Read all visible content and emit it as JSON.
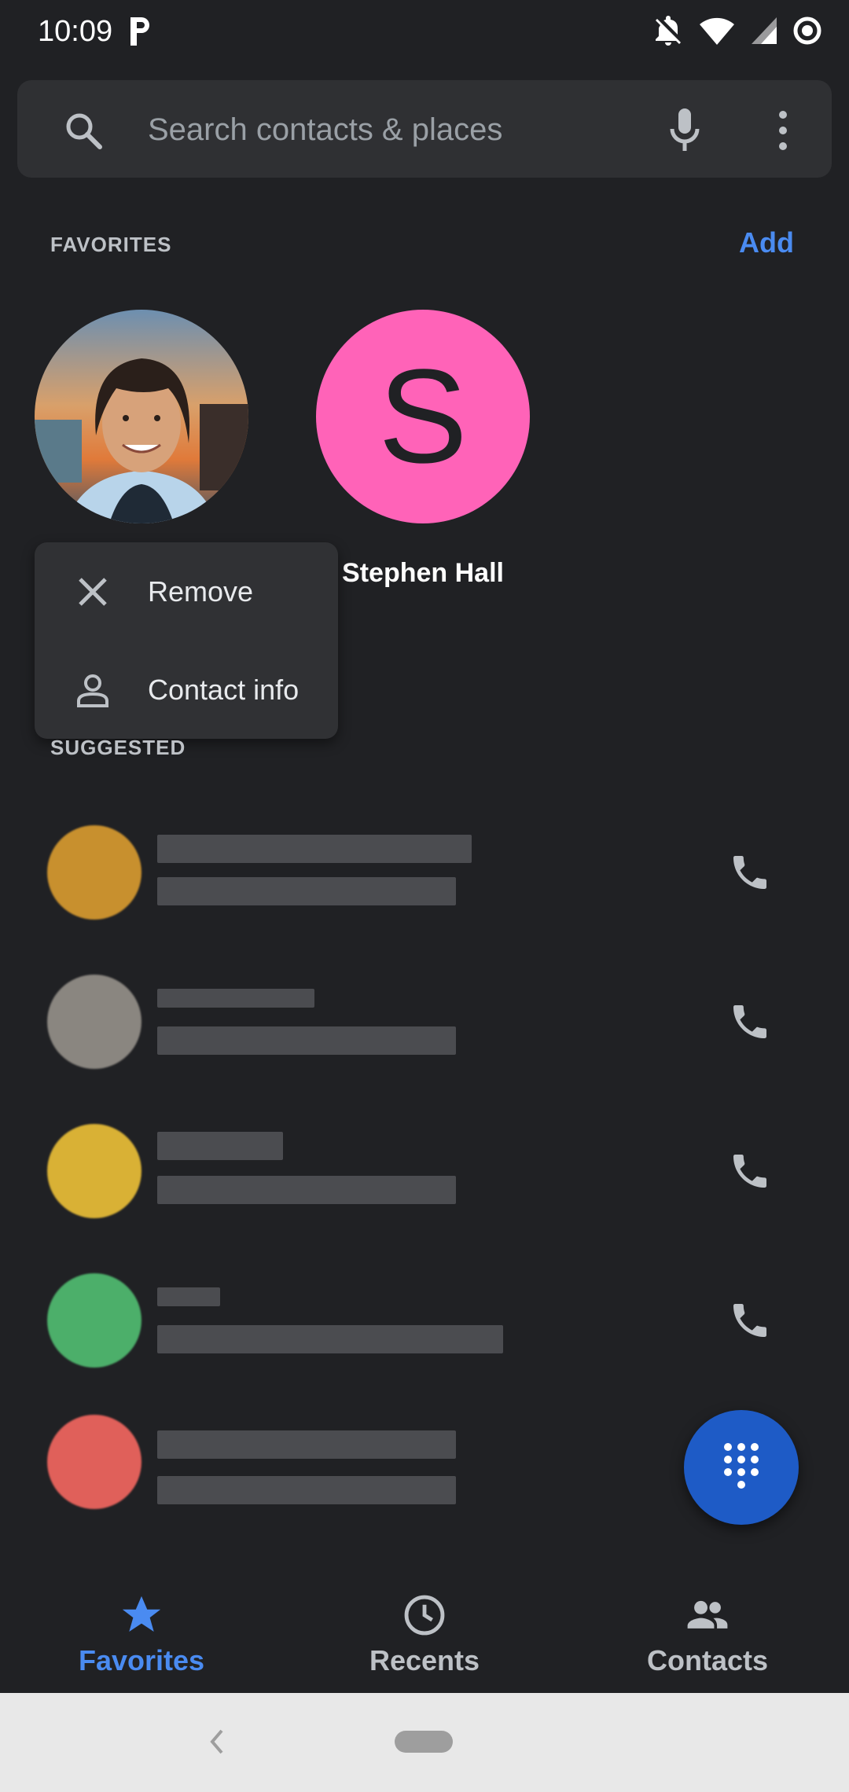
{
  "status_bar": {
    "time": "10:09",
    "icons": [
      "parking-icon",
      "notifications-off-icon",
      "wifi-icon",
      "signal-icon",
      "record-icon"
    ]
  },
  "search": {
    "placeholder": "Search contacts & places",
    "icons": [
      "search-icon",
      "mic-icon",
      "more-vert-icon"
    ]
  },
  "favorites": {
    "title": "FAVORITES",
    "add_label": "Add",
    "contacts": [
      {
        "name": "",
        "avatar": "photo"
      },
      {
        "name": "Stephen Hall",
        "avatar_letter": "S",
        "avatar_color": "#ff63b8"
      }
    ]
  },
  "context_menu": {
    "items": [
      {
        "label": "Remove",
        "icon": "close-icon"
      },
      {
        "label": "Contact info",
        "icon": "person-icon"
      }
    ]
  },
  "suggested": {
    "title": "SUGGESTED",
    "rows": [
      {
        "avatar_color": "#c8902e",
        "blurred": true,
        "icon": "call-icon"
      },
      {
        "avatar_color": "#8a8680",
        "blurred": true,
        "icon": "call-icon"
      },
      {
        "avatar_color": "#d9b135",
        "blurred": true,
        "icon": "call-icon"
      },
      {
        "avatar_color": "#4caf6a",
        "blurred": true,
        "icon": "call-icon"
      },
      {
        "avatar_color": "#e0605a",
        "blurred": true,
        "icon": ""
      }
    ]
  },
  "fab": {
    "icon": "dialpad-icon"
  },
  "bottom_nav": {
    "items": [
      {
        "label": "Favorites",
        "icon": "star-icon",
        "active": true
      },
      {
        "label": "Recents",
        "icon": "clock-icon",
        "active": false
      },
      {
        "label": "Contacts",
        "icon": "people-icon",
        "active": false
      }
    ],
    "active_color": "#4a8bf1",
    "inactive_color": "#bdc1c6"
  },
  "system_nav": {
    "icons": [
      "back-icon",
      "home-pill"
    ]
  }
}
